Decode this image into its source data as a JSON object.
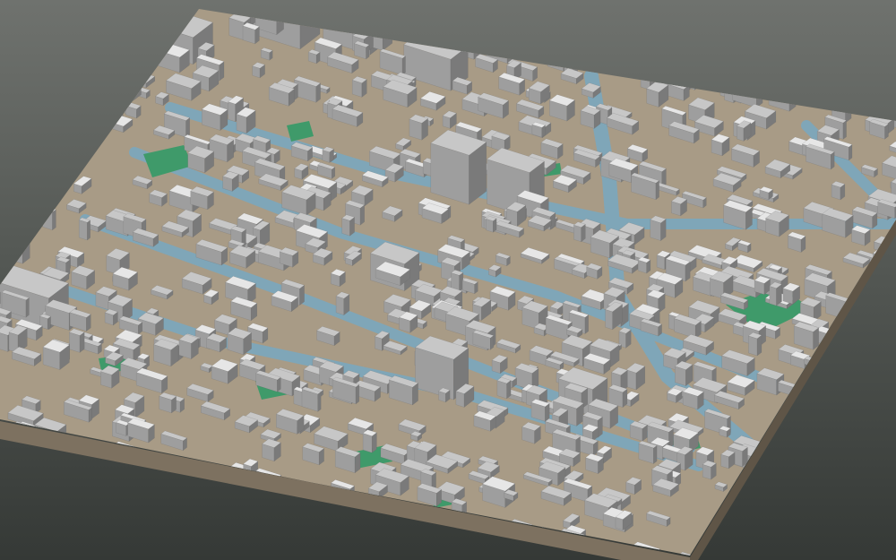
{
  "scene": {
    "kind": "3d-city-block-model",
    "view": "oblique-isometric",
    "interaction": "none-visible",
    "colors": {
      "background_top": "#6f726e",
      "background_bottom": "#353936",
      "ground": "#a89b86",
      "base_front": "#7d7160",
      "base_side": "#5f5547",
      "water": "#7fa6b8",
      "green": "#3f9a6a",
      "building_top": "#c7c7c7",
      "building_side": "#9e9e9e",
      "building_dark": "#7a7a7a",
      "roof_light": "#e6e6e6"
    },
    "features": [
      "buildings",
      "canals",
      "streets",
      "green-spaces",
      "terrain-base"
    ]
  }
}
